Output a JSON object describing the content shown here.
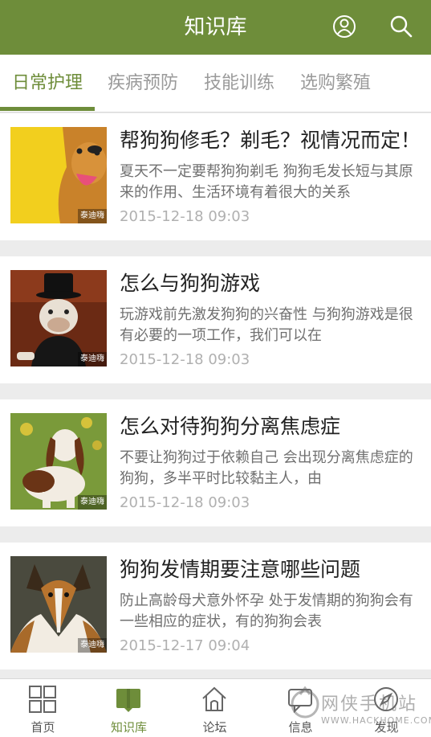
{
  "header": {
    "title": "知识库",
    "user_icon": "user-icon",
    "search_icon": "search-icon"
  },
  "tabs": [
    {
      "label": "日常护理",
      "active": true
    },
    {
      "label": "疾病预防",
      "active": false
    },
    {
      "label": "技能训练",
      "active": false
    },
    {
      "label": "选购繁殖",
      "active": false
    }
  ],
  "articles": [
    {
      "title": "帮狗狗修毛？剃毛？视情况而定！",
      "desc": "夏天不一定要帮狗狗剃毛 狗狗毛发长短与其原来的作用、生活环境有着很大的关系",
      "date": "2015-12-18 09:03",
      "watermark": "泰迪嗨"
    },
    {
      "title": "怎么与狗狗游戏",
      "desc": "玩游戏前先激发狗狗的兴奋性 与狗狗游戏是很有必要的一项工作，我们可以在",
      "date": "2015-12-18 09:03",
      "watermark": "泰迪嗨"
    },
    {
      "title": "怎么对待狗狗分离焦虑症",
      "desc": "不要让狗狗过于依赖自己 会出现分离焦虑症的狗狗，多半平时比较黏主人，由",
      "date": "2015-12-18 09:03",
      "watermark": "泰迪嗨"
    },
    {
      "title": "狗狗发情期要注意哪些问题",
      "desc": "防止高龄母犬意外怀孕 处于发情期的狗狗会有一些相应的症状，有的狗狗会表",
      "date": "2015-12-17 09:04",
      "watermark": "泰迪嗨"
    }
  ],
  "bottom_nav": [
    {
      "label": "首页",
      "icon": "grid-icon",
      "active": false
    },
    {
      "label": "知识库",
      "icon": "book-icon",
      "active": true
    },
    {
      "label": "论坛",
      "icon": "home-icon",
      "active": false
    },
    {
      "label": "信息",
      "icon": "message-icon",
      "active": false
    },
    {
      "label": "发现",
      "icon": "compass-icon",
      "active": false
    }
  ],
  "site_watermark": {
    "cn": "网侠手机站",
    "en": "WWW.HACKHOME.COM"
  },
  "colors": {
    "accent": "#6e8d3a",
    "background": "#ececec"
  }
}
